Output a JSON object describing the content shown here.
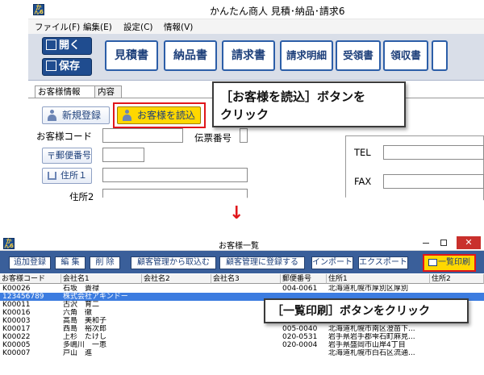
{
  "top_window": {
    "title": "かんたん商人 見積･納品･請求6",
    "app_icon_text": "かん6",
    "menu": [
      "ファイル(F)",
      "編集(E)",
      "設定(C)",
      "情報(V)"
    ],
    "open_label": "開く",
    "save_label": "保存",
    "doc_buttons": [
      "見積書",
      "納品書",
      "請求書",
      "請求明細",
      "受領書",
      "領収書"
    ],
    "tabs": [
      "お客様情報",
      "内容"
    ],
    "new_register_label": "新規登録",
    "load_customer_label": "お客様を読込",
    "customer_code_label": "お客様コード",
    "slip_number_label": "伝票番号",
    "postal_code_label": "郵便番号",
    "address1_label": "住所１",
    "address2_label": "住所2",
    "tel_label": "TEL",
    "fax_label": "FAX",
    "callout_line1": "［お客様を読込］ボタンを",
    "callout_line2": "クリック"
  },
  "arrow_glyph": "↓",
  "bottom_window": {
    "title": "お客様一覧",
    "toolbar": [
      "追加登録",
      "編 集",
      "削 除",
      "顧客管理から取込む",
      "顧客管理に登録する",
      "インポート",
      "エクスポート"
    ],
    "print_list_label": "一覧印刷",
    "columns": [
      "お客様コード",
      "会社名1",
      "会社名2",
      "会社名3",
      "郵便番号",
      "住所1",
      "住所2"
    ],
    "rows": [
      {
        "code": "K00026",
        "name": "石坂　貴禄",
        "zip": "004-0061",
        "addr": "北海道札幌市厚別区厚別"
      },
      {
        "code": "123456789",
        "name": "株式会社アキンドー",
        "zip": "",
        "addr": "",
        "selected": true
      },
      {
        "code": "K00011",
        "name": "古沢　育二",
        "zip": "",
        "addr": ""
      },
      {
        "code": "K00016",
        "name": "六角　徹",
        "zip": "",
        "addr": ""
      },
      {
        "code": "K00003",
        "name": "高島　美和子",
        "zip": "",
        "addr": ""
      },
      {
        "code": "K00017",
        "name": "西島　裕次郎",
        "zip": "005-0040",
        "addr": "北海道札幌市南区澄苗下..."
      },
      {
        "code": "K00022",
        "name": "上杉　たけし",
        "zip": "020-0531",
        "addr": "岩手県岩手郡雫石町麻見..."
      },
      {
        "code": "K00005",
        "name": "多嶋川　一恵",
        "zip": "020-0004",
        "addr": "岩手県盛岡市山岸4丁目"
      },
      {
        "code": "K00007",
        "name": "戸山　進",
        "zip": "",
        "addr": "北海道札幌市白石区流通..."
      }
    ],
    "callout": "［一覧印刷］ボタンをクリック"
  }
}
